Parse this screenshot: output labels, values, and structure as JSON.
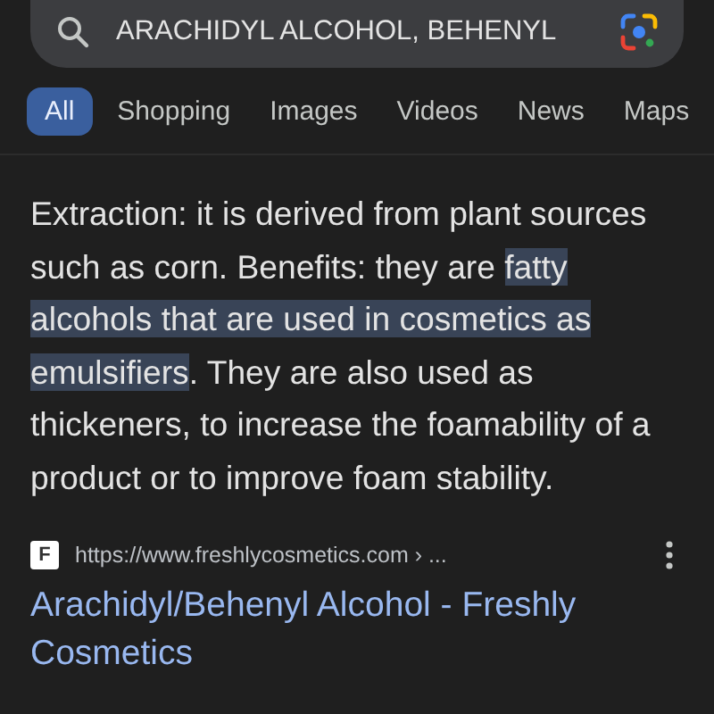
{
  "search": {
    "value": "ARACHIDYL ALCOHOL, BEHENYL"
  },
  "tabs": [
    {
      "label": "All",
      "selected": true
    },
    {
      "label": "Shopping",
      "selected": false
    },
    {
      "label": "Images",
      "selected": false
    },
    {
      "label": "Videos",
      "selected": false
    },
    {
      "label": "News",
      "selected": false
    },
    {
      "label": "Maps",
      "selected": false
    }
  ],
  "snippet": [
    {
      "text": "Extraction: it is derived from plant sources such as corn. Benefits: they are ",
      "highlighted": false
    },
    {
      "text": "fatty alcohols that are used in cosmetics as emulsifiers",
      "highlighted": true
    },
    {
      "text": ". They are also used as thickeners, to increase the foamability of a product or to improve foam stability.",
      "highlighted": false
    }
  ],
  "result": {
    "favicon_letter": "F",
    "url": "https://www.freshlycosmetics.com › ...",
    "title": "Arachidyl/Behenyl Alcohol - Freshly Cosmetics"
  }
}
